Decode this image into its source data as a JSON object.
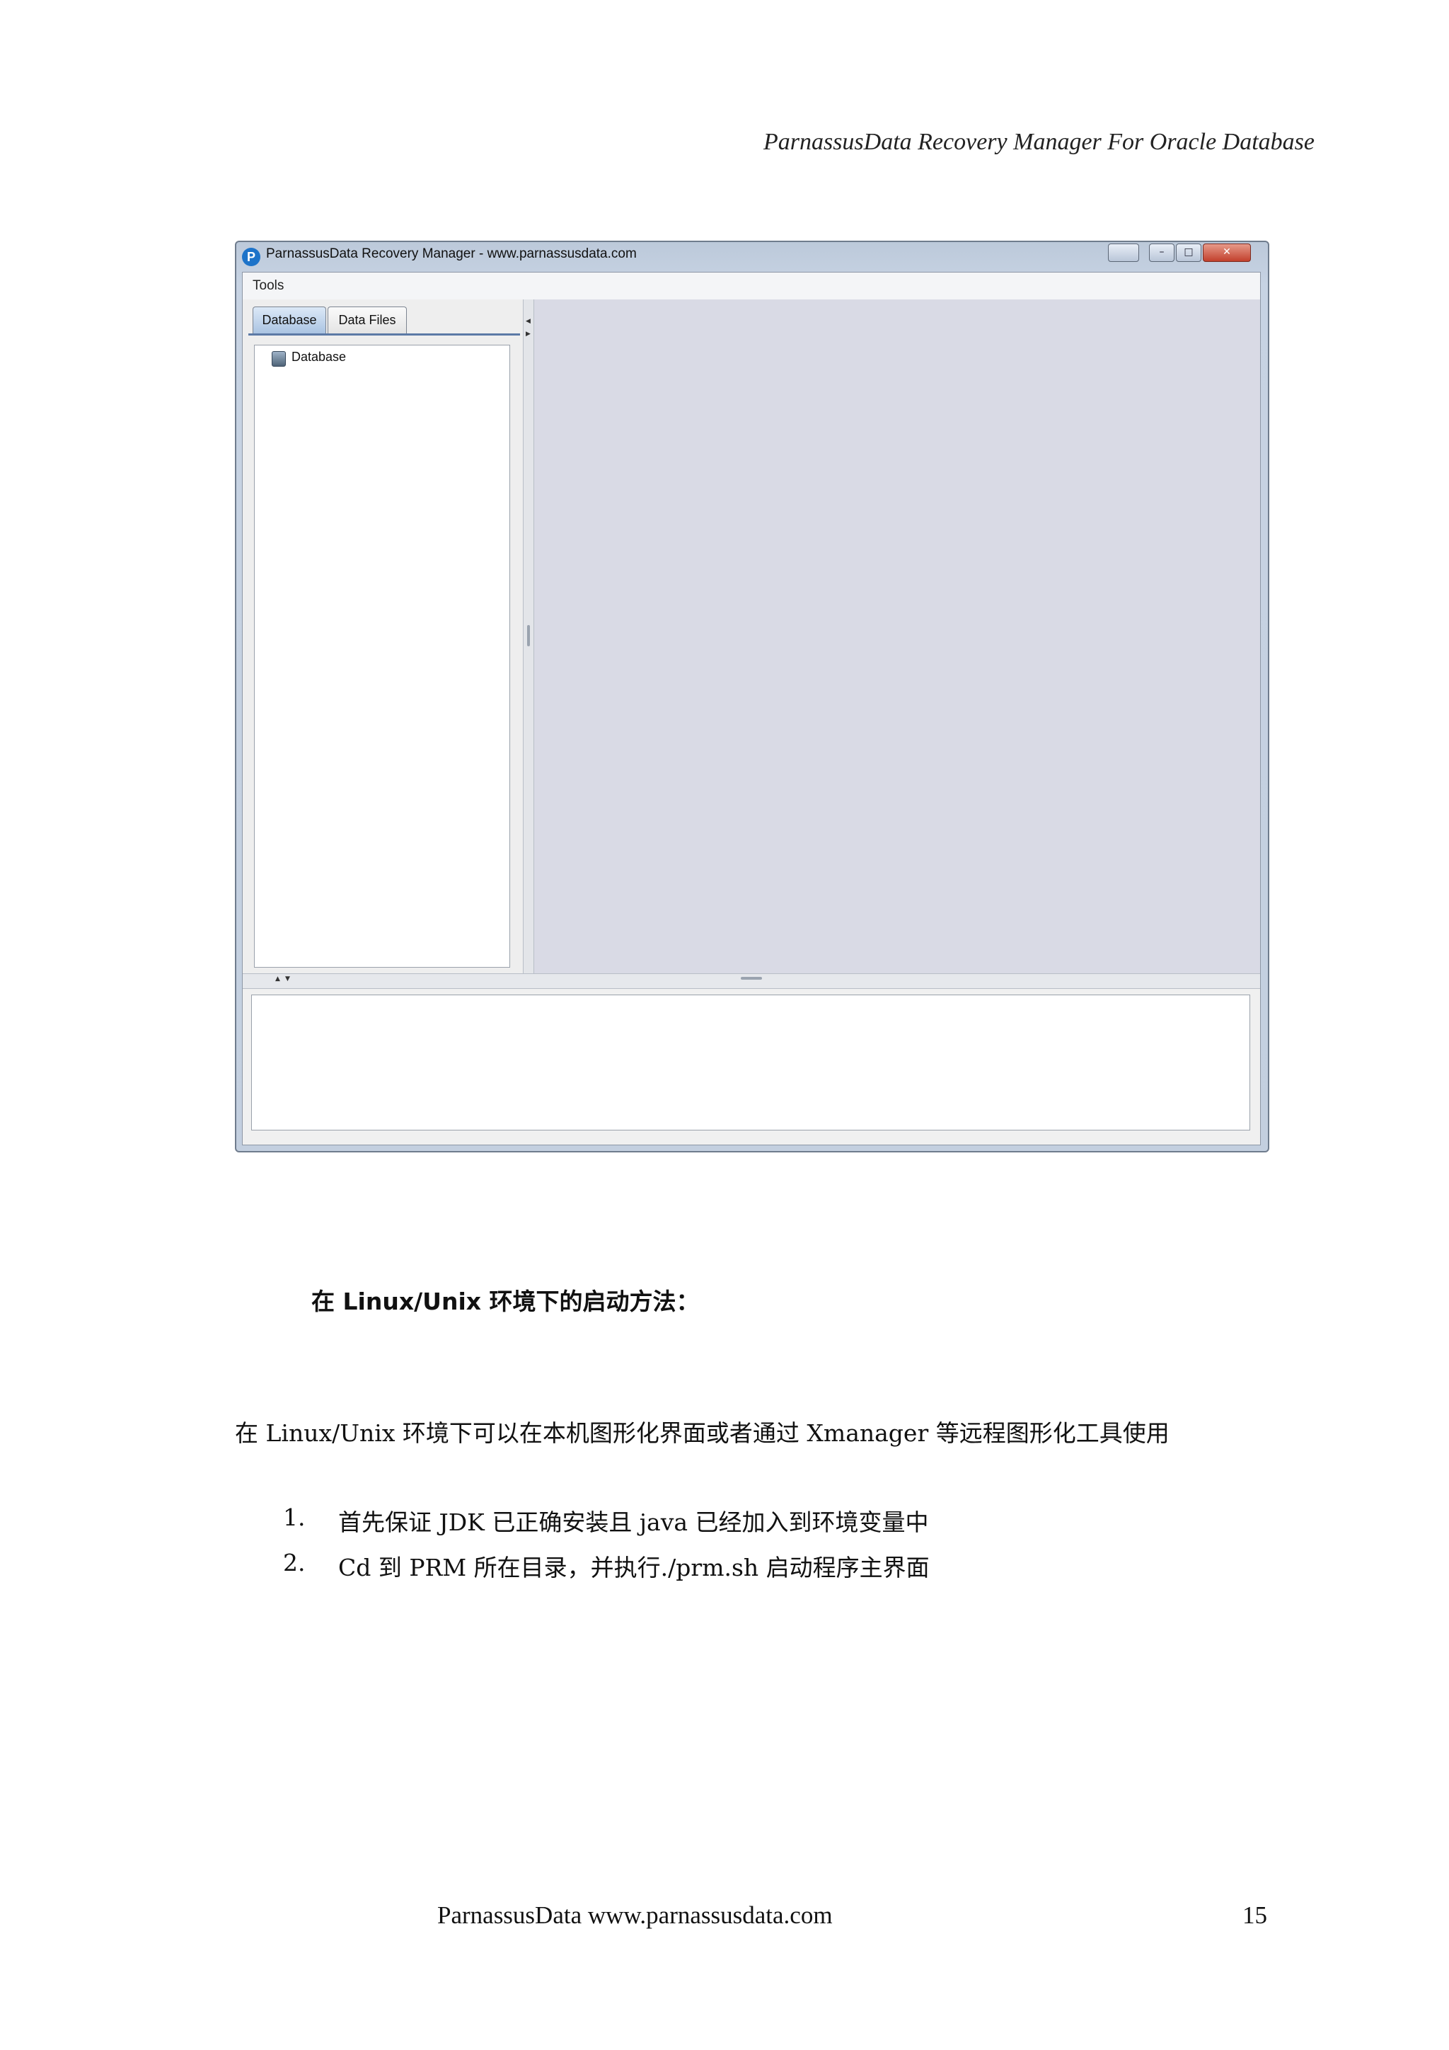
{
  "header": {
    "title": "ParnassusData Recovery Manager For Oracle Database"
  },
  "screenshot": {
    "window_title": "ParnassusData Recovery Manager - www.parnassusdata.com",
    "logo_letter": "P",
    "menu": {
      "tools": "Tools"
    },
    "tabs": [
      "Database",
      "Data Files"
    ],
    "tree": {
      "root_label": "Database"
    },
    "window_controls": {
      "minimize": "–",
      "maximize": "□",
      "close": "✕"
    }
  },
  "content": {
    "heading": "在 Linux/Unix 环境下的启动方法：",
    "paragraph": "在 Linux/Unix 环境下可以在本机图形化界面或者通过 Xmanager 等远程图形化工具使用",
    "steps": [
      {
        "num": "1.",
        "text": "首先保证 JDK 已正确安装且 java 已经加入到环境变量中"
      },
      {
        "num": "2.",
        "text": "Cd 到 PRM 所在目录，并执行./prm.sh 启动程序主界面"
      }
    ]
  },
  "footer": {
    "text": "ParnassusData www.parnassusdata.com",
    "page_number": "15"
  }
}
